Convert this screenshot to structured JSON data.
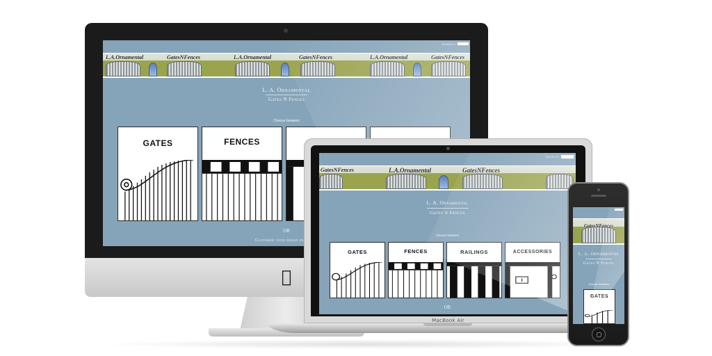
{
  "site": {
    "search_label": "SEARCH",
    "brand_name": "L. A. Ornamental",
    "brand_sub": "Gates N Fences",
    "choose_text": "Choose between",
    "or_text": "OR",
    "customize_text": "Customize your design exactly a",
    "banner_signs": [
      "L.A.Ornamental",
      "GatesNFences"
    ],
    "cards": [
      {
        "label": "GATES"
      },
      {
        "label": "FENCES"
      },
      {
        "label": "RAILINGS"
      },
      {
        "label": "ACCESSORIES"
      }
    ]
  },
  "devices": {
    "laptop_label": "MacBook Air"
  },
  "colors": {
    "site_background": "#86a4b9",
    "banner_wall": "#9aa44e",
    "card_background": "#ffffff"
  }
}
